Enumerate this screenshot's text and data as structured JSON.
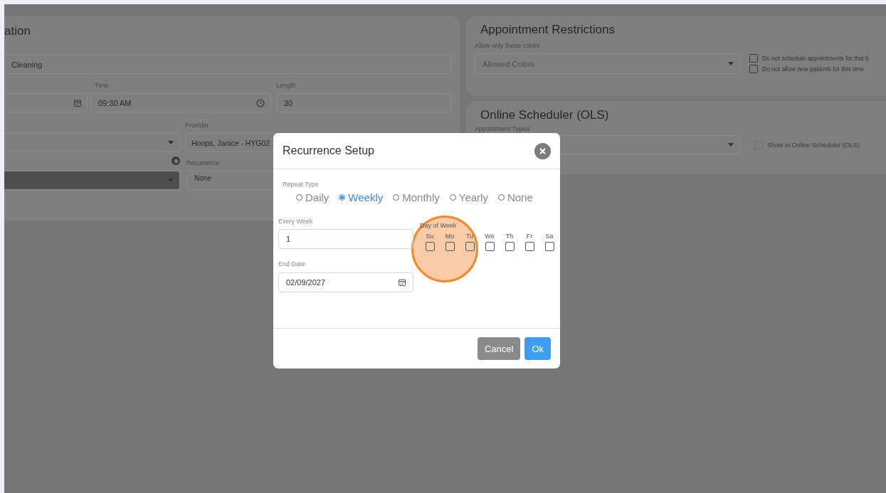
{
  "appointment_panel": {
    "title": "ation",
    "description_field": {
      "value": "Cleaning"
    },
    "time_field": {
      "label": "Time",
      "value": "09:30 AM"
    },
    "length_field": {
      "label": "Length",
      "value": "30"
    },
    "provider_field": {
      "label": "Provider",
      "value": "Hoops, Janice - HYG02"
    },
    "recurrence_field": {
      "label": "Recurrence",
      "value": "None"
    }
  },
  "restrictions_panel": {
    "title": "Appointment Restrictions",
    "colors_label": "Allow only these colors",
    "colors_placeholder": "Allowed Colors",
    "options": [
      {
        "label": "Do not schedule appointments for this ti",
        "checked": false
      },
      {
        "label": "Do not allow new patients for this time",
        "checked": false
      }
    ]
  },
  "ols_panel": {
    "title": "Online Scheduler (OLS)",
    "types_label": "Appointment Types",
    "option": {
      "label": "Show in Online Scheduler (OLS)",
      "checked": false
    }
  },
  "modal": {
    "title": "Recurrence Setup",
    "repeat_label": "Repeat Type",
    "repeat_types": [
      {
        "label": "Daily",
        "selected": false
      },
      {
        "label": "Weekly",
        "selected": true
      },
      {
        "label": "Monthly",
        "selected": false
      },
      {
        "label": "Yearly",
        "selected": false
      },
      {
        "label": "None",
        "selected": false
      }
    ],
    "every_week": {
      "label": "Every Week",
      "value": "1"
    },
    "end_date": {
      "label": "End Date",
      "value": "02/09/2027"
    },
    "day_label": "Day of Week",
    "days": [
      {
        "label": "Su",
        "checked": false
      },
      {
        "label": "Mo",
        "checked": false
      },
      {
        "label": "Tu",
        "checked": false
      },
      {
        "label": "We",
        "checked": false
      },
      {
        "label": "Th",
        "checked": false
      },
      {
        "label": "Fr",
        "checked": false
      },
      {
        "label": "Sa",
        "checked": false
      }
    ],
    "buttons": [
      {
        "label": "Cancel",
        "kind": "secondary"
      },
      {
        "label": "Ok",
        "kind": "primary"
      }
    ]
  }
}
